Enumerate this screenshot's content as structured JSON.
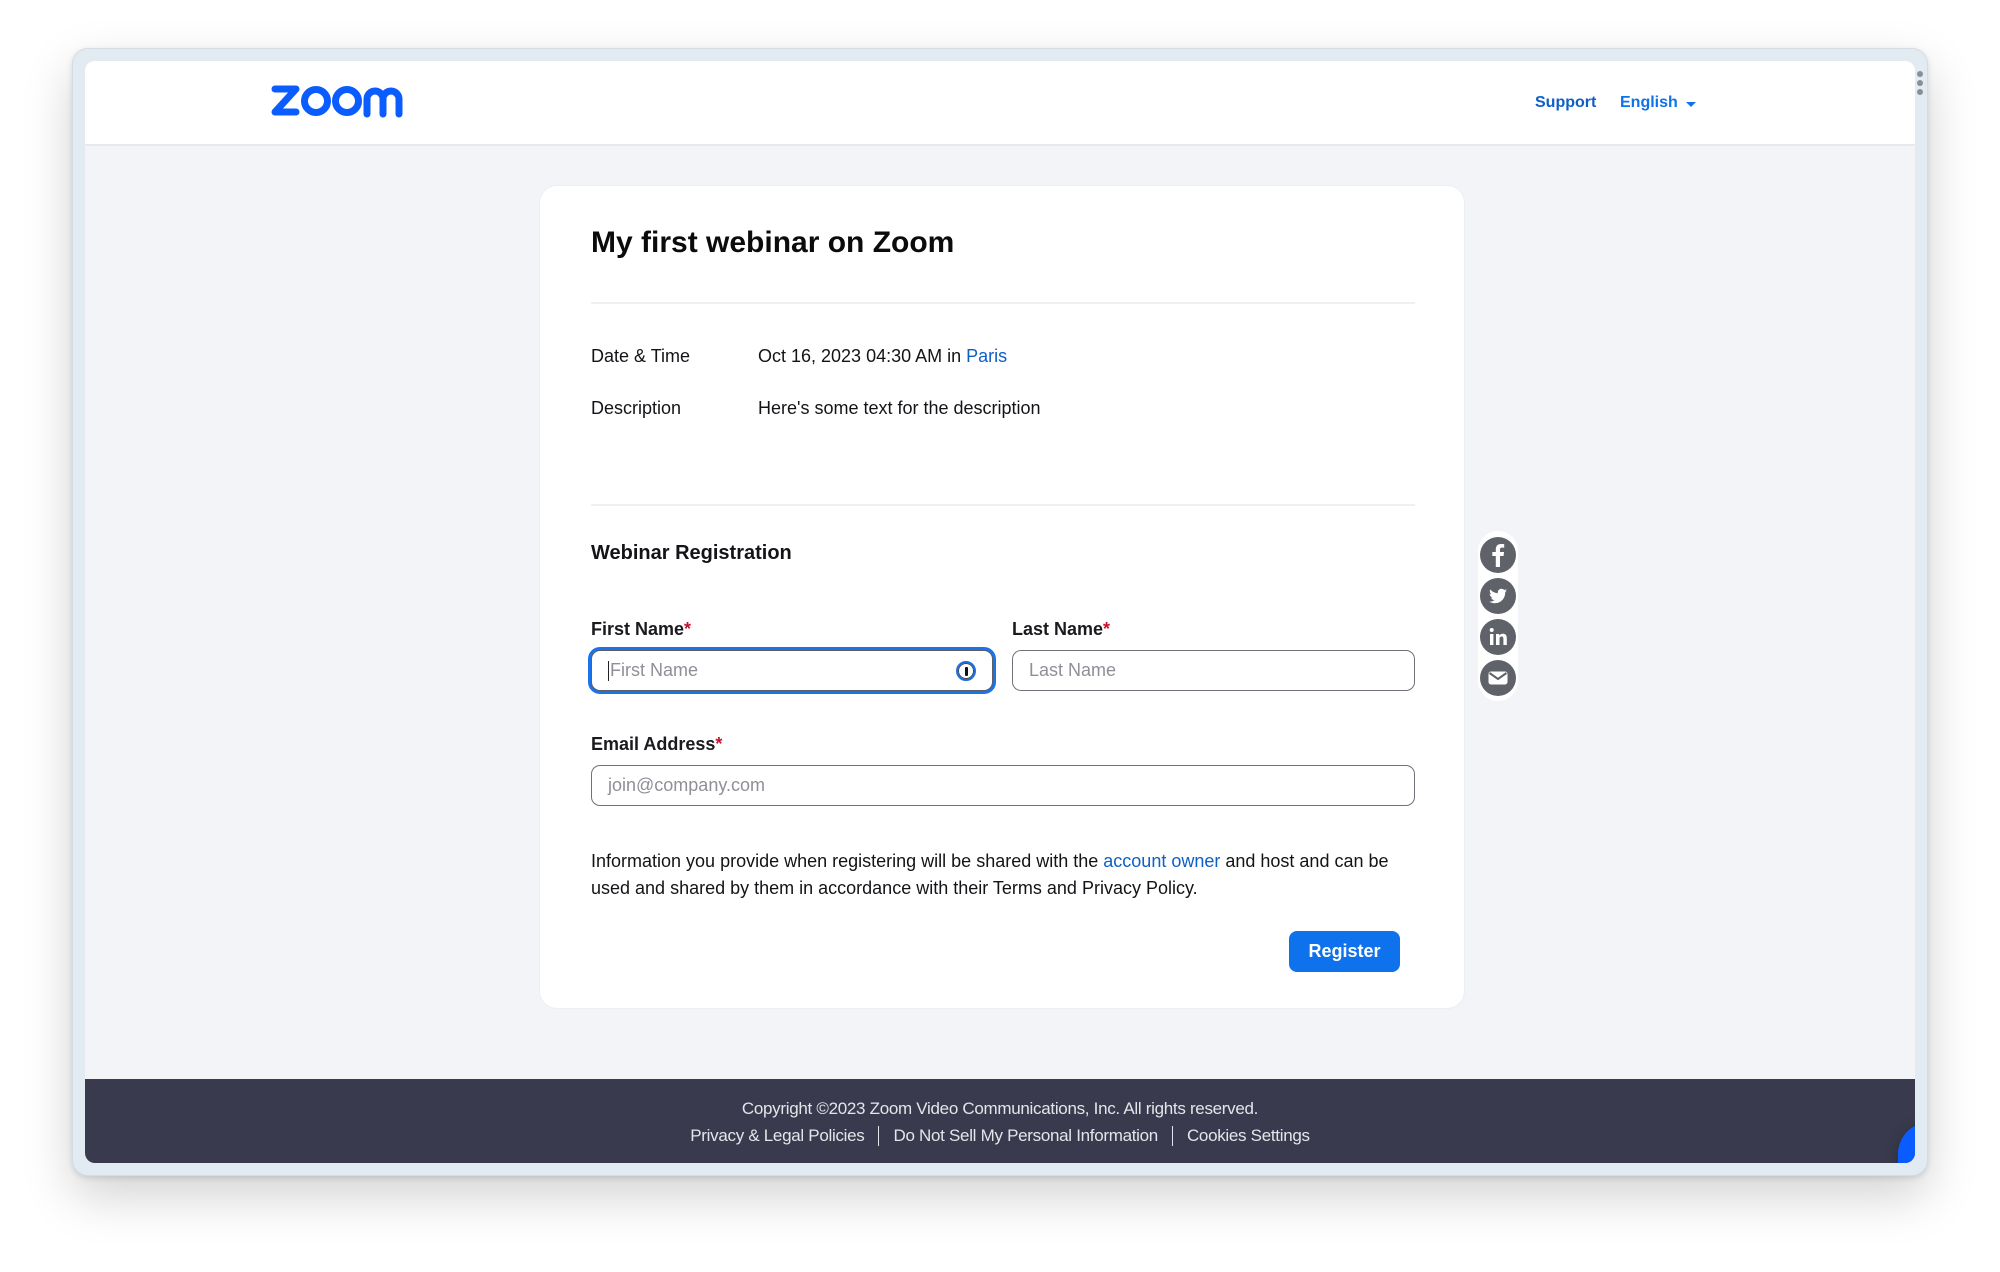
{
  "header": {
    "logo_text": "zoom",
    "support_label": "Support",
    "language_label": "English"
  },
  "webinar": {
    "title": "My first webinar on Zoom",
    "date_label": "Date & Time",
    "date_value": "Oct 16, 2023 04:30 AM in ",
    "timezone_link": "Paris",
    "description_label": "Description",
    "description_value": "Here's some text for the description"
  },
  "registration": {
    "section_title": "Webinar Registration",
    "required_marker": "*",
    "first_name": {
      "label": "First Name",
      "placeholder": "First Name",
      "value": ""
    },
    "last_name": {
      "label": "Last Name",
      "placeholder": "Last Name",
      "value": ""
    },
    "email": {
      "label": "Email Address",
      "placeholder": "join@company.com",
      "value": ""
    },
    "notice_before": "Information you provide when registering will be shared with the ",
    "notice_link": "account owner",
    "notice_after": " and host and can be used and shared by them in accordance with their Terms and Privacy Policy.",
    "register_label": "Register"
  },
  "share": {
    "items": [
      {
        "icon": "facebook-icon"
      },
      {
        "icon": "twitter-icon"
      },
      {
        "icon": "linkedin-icon"
      },
      {
        "icon": "email-icon"
      }
    ]
  },
  "footer": {
    "copyright": "Copyright ©2023 Zoom Video Communications, Inc. All rights reserved.",
    "links": [
      "Privacy & Legal Policies",
      "Do Not Sell My Personal Information",
      "Cookies Settings"
    ]
  },
  "colors": {
    "brand": "#0b5cff",
    "link": "#0e5fc6",
    "button": "#0e72ed",
    "footer_bg": "#393a4d",
    "required": "#c8102e"
  }
}
